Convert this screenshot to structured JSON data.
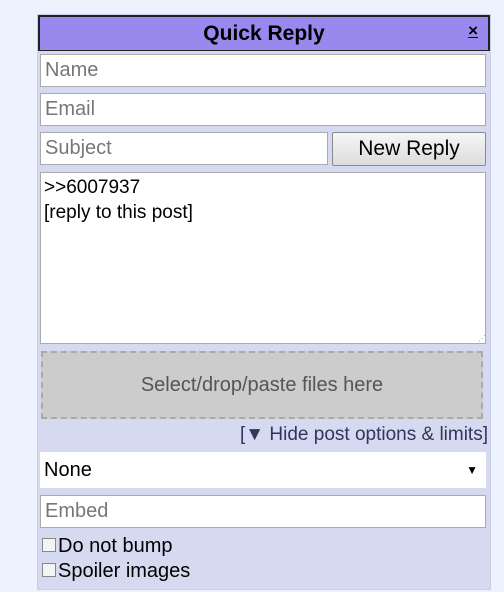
{
  "quick_reply": {
    "title": "Quick Reply",
    "close_label": "×",
    "name_placeholder": "Name",
    "email_placeholder": "Email",
    "subject_placeholder": "Subject",
    "submit_label": "New Reply",
    "comment_value": ">>6007937\n[reply to this post]",
    "dropzone_label": "Select/drop/paste files here",
    "options_link": "[▼ Hide post options & limits]",
    "flag_select_value": "None",
    "embed_placeholder": "Embed",
    "checkboxes": [
      {
        "label": "Do not bump",
        "checked": false
      },
      {
        "label": "Spoiler images",
        "checked": false
      }
    ]
  }
}
